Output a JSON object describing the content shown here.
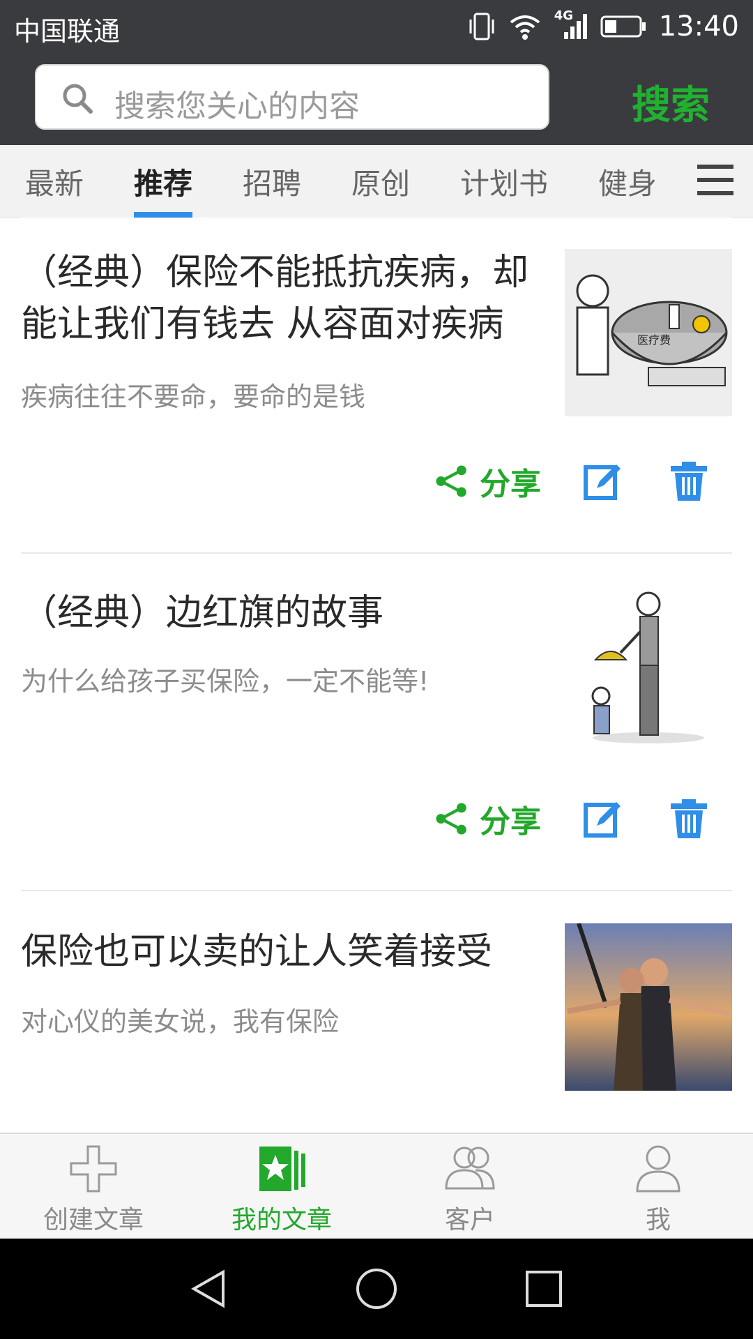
{
  "status_bar": {
    "carrier": "中国联通",
    "network": "4G",
    "time": "13:40"
  },
  "search": {
    "placeholder": "搜索您关心的内容",
    "button_label": "搜索"
  },
  "tabs": [
    {
      "label": "最新"
    },
    {
      "label": "推荐",
      "active": true
    },
    {
      "label": "招聘"
    },
    {
      "label": "原创"
    },
    {
      "label": "计划书"
    },
    {
      "label": "健身"
    }
  ],
  "articles": [
    {
      "title_line1": "（经典）保险不能抵抗疾病，却",
      "title_line2": "能让我们有钱去 从容面对疾病",
      "subtitle": "疾病往往不要命，要命的是钱",
      "share_label": "分享",
      "image_text": "医疗费"
    },
    {
      "title_line1": "（经典）边红旗的故事",
      "subtitle": "为什么给孩子买保险，一定不能等!",
      "share_label": "分享"
    },
    {
      "title_line1": "保险也可以卖的让人笑着接受",
      "subtitle": "对心仪的美女说，我有保险"
    }
  ],
  "bottom_nav": [
    {
      "label": "创建文章"
    },
    {
      "label": "我的文章",
      "active": true
    },
    {
      "label": "客户"
    },
    {
      "label": "我"
    }
  ],
  "colors": {
    "accent_green": "#22b030",
    "accent_blue": "#2f8ee8",
    "header_bg": "#3a3b3f"
  }
}
